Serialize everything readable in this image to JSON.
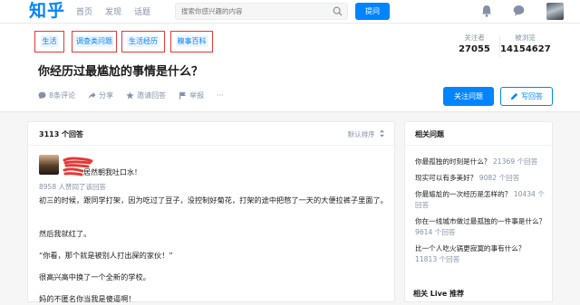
{
  "brand": {
    "logo": "知乎",
    "accent": "#0084ff"
  },
  "nav": {
    "items": [
      "首页",
      "发现",
      "话题"
    ]
  },
  "search": {
    "placeholder": "搜索你感兴趣的内容"
  },
  "header": {
    "ask_label": "提问"
  },
  "question": {
    "tags": [
      "生活",
      "调查类问题",
      "生活经历",
      "糗事百科"
    ],
    "title": "你经历过最尴尬的事情是什么？",
    "followers_label": "关注者",
    "followers": "27055",
    "views_label": "被浏览",
    "views": "14154627",
    "actions": {
      "comments": "8条评论",
      "share": "分享",
      "invite": "邀请回答",
      "report": "举报",
      "more": "···"
    },
    "follow_label": "关注问题",
    "write_label": "写回答"
  },
  "answers": {
    "count": "3113 个回答",
    "sort": "默认排序",
    "author_suffix": "居然朝我吐口水！",
    "likes": "8958 人赞同了该回答",
    "paragraphs": [
      "初三的时候，跟同学打架，因为吃过了豆子，没控制好菊花，打架的途中把憋了一天的大便拉裤子里面了。",
      "然后我就红了。",
      "“你看，那个就是被别人打出屎的家伙！”",
      "很高兴高中换了一个全新的学校。",
      "妈的不匿名你当我是傻逼啊！"
    ]
  },
  "related": {
    "title": "相关问题",
    "items": [
      {
        "q": "你最孤独的时刻是什么？",
        "n": "21369 个回答"
      },
      {
        "q": "现实可以有多美好？",
        "n": "9082 个回答"
      },
      {
        "q": "你最尴尬的一次经历是怎样的？",
        "n": "10434 个回答"
      },
      {
        "q": "你在一线城市做过最孤独的一件事是什么？",
        "n": "9614 个回答"
      },
      {
        "q": "比一个人吃火锅更寂寞的事有什么？",
        "n": "11813 个回答"
      }
    ],
    "next_section": "相关 Live 推荐"
  }
}
